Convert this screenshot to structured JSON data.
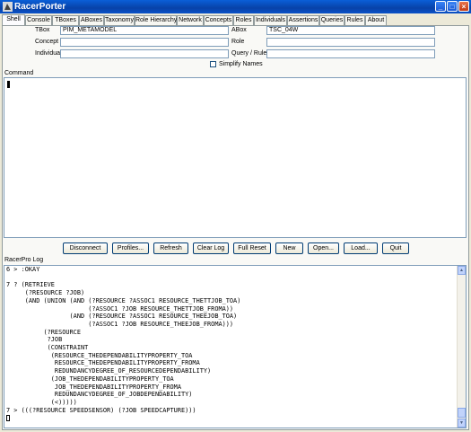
{
  "window": {
    "title": "RacerPorter",
    "minimize": "_",
    "maximize": "□",
    "close": "×"
  },
  "tabs": [
    {
      "label": "Shell"
    },
    {
      "label": "Console"
    },
    {
      "label": "TBoxes"
    },
    {
      "label": "ABoxes"
    },
    {
      "label": "Taxonomy"
    },
    {
      "label": "Role Hierarchy"
    },
    {
      "label": "Network"
    },
    {
      "label": "Concepts"
    },
    {
      "label": "Roles"
    },
    {
      "label": "Individuals"
    },
    {
      "label": "Assertions"
    },
    {
      "label": "Queries"
    },
    {
      "label": "Rules"
    },
    {
      "label": "About"
    }
  ],
  "active_tab": "Shell",
  "form": {
    "tbox_label": "TBox",
    "tbox_value": "PIM_METAMODEL",
    "abox_label": "ABox",
    "abox_value": "TSC_04W",
    "concept_label": "Concept",
    "concept_value": "",
    "role_label": "Role",
    "role_value": "",
    "individual_label": "Individual",
    "individual_value": "",
    "query_label": "Query / Rule",
    "query_value": "",
    "simplify_label": "Simplify Names",
    "simplify_checked": false
  },
  "command": {
    "label": "Command",
    "value": ""
  },
  "buttons": {
    "disconnect": "Disconnect",
    "profiles": "Profiles...",
    "refresh": "Refresh",
    "clear_log": "Clear Log",
    "full_reset": "Full Reset",
    "new": "New",
    "open": "Open...",
    "load": "Load...",
    "quit": "Quit"
  },
  "log": {
    "label": "RacerPro Log",
    "text": "6 > :OKAY\n\n7 ? (RETRIEVE\n     (?RESOURCE ?JOB)\n     (AND (UNION (AND (?RESOURCE ?ASSOC1 RESOURCE_THETTJOB_TOA)\n                      (?ASSOC1 ?JOB RESOURCE_THETTJOB_FROMA))\n                 (AND (?RESOURCE ?ASSOC1 RESOURCE_THEEJOB_TOA)\n                      (?ASSOC1 ?JOB RESOURCE_THEEJOB_FROMA)))\n          (?RESOURCE\n           ?JOB\n           (CONSTRAINT\n            (RESOURCE_THEDEPENDABILITYPROPERTY_TOA\n             RESOURCE_THEDEPENDABILITYPROPERTY_FROMA\n             REDUNDANCYDEGREE_OF_RESOURCEDEPENDABILITY)\n            (JOB_THEDEPENDABILITYPROPERTY_TOA\n             JOB_THEDEPENDABILITYPROPERTY_FROMA\n             REDUNDANCYDEGREE_OF_JOBDEPENDABILITY)\n            (<)))))\n7 > (((?RESOURCE SPEEDSENSOR) (?JOB SPEEDCAPTURE)))"
  }
}
